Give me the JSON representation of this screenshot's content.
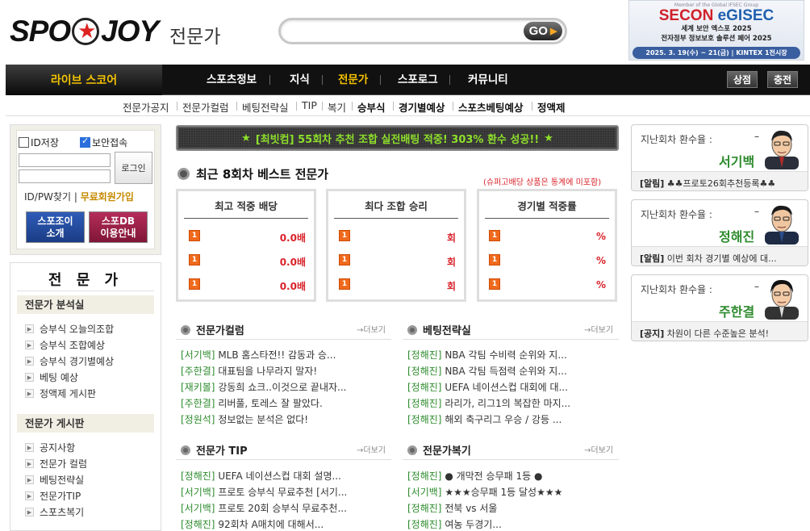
{
  "header": {
    "logo_left": "SPO",
    "logo_right": "JOY",
    "subtitle": "전문가",
    "search_placeholder": "",
    "go_label": "GO"
  },
  "ad": {
    "small": "Member of the Global IFSEC Group",
    "brand1": "SECON",
    "brand2": "eGISEC",
    "line1": "세계 보안 엑스포 2025",
    "line2": "전자정부 정보보호 솔루션 페어 2025",
    "date": "2025. 3. 19(수) ~ 21(금) | KINTEX 1전시장"
  },
  "nav": {
    "live": "라이브 스코어",
    "items": [
      "스포츠정보",
      "지식",
      "전문가",
      "스포로그",
      "커뮤니티"
    ],
    "active": "전문가",
    "right_buttons": [
      "상점",
      "충전"
    ]
  },
  "subnav": {
    "items": [
      "전문가공지",
      "전문가컬럼",
      "베팅전략실",
      "TIP",
      "복기",
      "승부식",
      "경기별예상",
      "스포츠베팅예상",
      "정액제"
    ]
  },
  "login": {
    "save_id": "ID저장",
    "secure": "보안접속",
    "login_button": "로그인",
    "find": "ID/PW찾기",
    "signup": "무료회원가입",
    "btn1_line1": "스포조이",
    "btn1_line2": "소개",
    "btn2_line1": "스포DB",
    "btn2_line2": "이용안내"
  },
  "expert_menu": {
    "title": "전 문 가",
    "section1": "전문가 분석실",
    "section1_items": [
      "승부식 오늘의조합",
      "승부식 조합예상",
      "승부식 경기별예상",
      "베팅 예상",
      "정액제 게시판"
    ],
    "section2": "전문가 게시판",
    "section2_items": [
      "공지사항",
      "전문가 컬럼",
      "베팅전략실",
      "전문가TIP",
      "스포츠복기"
    ]
  },
  "banner": {
    "star": "★",
    "text": "[최빗컴] 55회차 추천 조합 실전배팅 적중! 303% 환수 성공!!"
  },
  "best": {
    "title": "최근 8회차 베스트 전문가",
    "note": "(슈퍼고배당 상품은 통계에 미포함)",
    "boxes": [
      {
        "title": "최고 적중 배당",
        "values": [
          "0.0배",
          "0.0배",
          "0.0배"
        ]
      },
      {
        "title": "최다 조합 승리",
        "values": [
          "회",
          "회",
          "회"
        ]
      },
      {
        "title": "경기별 적중률",
        "values": [
          "%",
          "%",
          "%"
        ]
      }
    ],
    "rank": "1"
  },
  "sections": {
    "more": "→더보기",
    "column": {
      "title": "전문가컬럼",
      "rows": [
        {
          "tag": "[서기백]",
          "text": "MLB 홈스타전!! 감동과 승..."
        },
        {
          "tag": "[주한결]",
          "text": "대표팀을 나무라지 말자!"
        },
        {
          "tag": "[재키볼]",
          "text": "강동희 쇼크..이것으로 끝내자..."
        },
        {
          "tag": "[주한결]",
          "text": "리버풀, 토레스 잘 팔았다."
        },
        {
          "tag": "[정원석]",
          "text": "정보없는 분석은 없다!"
        }
      ]
    },
    "strategy": {
      "title": "베팅전략실",
      "rows": [
        {
          "tag": "[정해진]",
          "text": "NBA 각팀 수비력 순위와 지..."
        },
        {
          "tag": "[정해진]",
          "text": "NBA 각팀 득점력 순위와 지..."
        },
        {
          "tag": "[정해진]",
          "text": "UEFA 네이션스컵 대회에 대..."
        },
        {
          "tag": "[정해진]",
          "text": "라리가, 리그1의 복잡한 마지..."
        },
        {
          "tag": "[정해진]",
          "text": "해외 축구리그 우승 / 강등 ..."
        }
      ]
    },
    "tip": {
      "title": "전문가 TIP",
      "rows": [
        {
          "tag": "[정해진]",
          "text": "UEFA 네이션스컵 대회 설명..."
        },
        {
          "tag": "[서기백]",
          "text": "프로토 승부식 무료추천 [서기..."
        },
        {
          "tag": "[서기백]",
          "text": "프로토 20회 승부식 무료추천..."
        },
        {
          "tag": "[정해진]",
          "text": "92회차 A매치에 대해서..."
        }
      ]
    },
    "review": {
      "title": "전문가복기",
      "rows": [
        {
          "tag": "[정해진]",
          "text": "● 개막전 승무패 1등 ●"
        },
        {
          "tag": "[서기백]",
          "text": "★★★승무패 1등 달성★★★"
        },
        {
          "tag": "[정해진]",
          "text": "전북 vs 서울"
        },
        {
          "tag": "[정해진]",
          "text": "여농 두경기..."
        }
      ]
    }
  },
  "experts": [
    {
      "label": "지난회차 환수율 :",
      "dash": "–",
      "name": "서기백",
      "notice_tag": "[알림]",
      "notice": "♣♣프로토26회추천등록♣♣"
    },
    {
      "label": "지난회차 환수율 :",
      "dash": "–",
      "name": "정해진",
      "notice_tag": "[알림]",
      "notice": "이번 회차 경기별 예상에 대..."
    },
    {
      "label": "지난회차 환수율 :",
      "dash": "–",
      "name": "주한결",
      "notice_tag": "[공지]",
      "notice": "차원이 다른 수준높은 분석!"
    }
  ],
  "colors": {
    "accent_yellow": "#f2c200",
    "tag_green": "#2d8b2d",
    "value_red": "#d9232b",
    "banner_green": "#8ee02b"
  }
}
